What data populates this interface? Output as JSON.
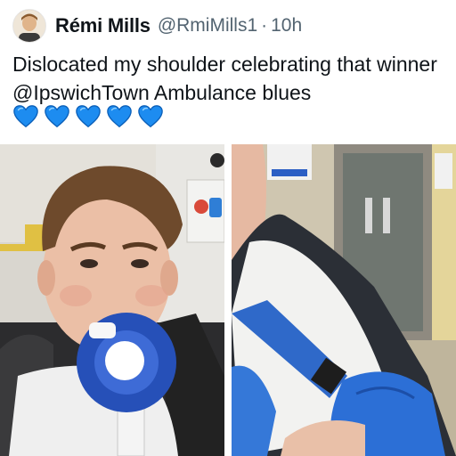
{
  "tweet": {
    "author_name": "Rémi Mills",
    "handle": "@RmiMills1",
    "separator": "·",
    "timestamp": "10h",
    "text_part1": "Dislocated my shoulder celebrating that winner ",
    "mention": "@IpswichTown",
    "text_part2": " Ambulance blues",
    "emoji": [
      "blue-heart",
      "blue-heart",
      "blue-heart",
      "blue-heart",
      "blue-heart"
    ],
    "emoji_color": "#1d8cf0"
  },
  "media": {
    "photos": [
      {
        "name": "selfie-with-gas-mask"
      },
      {
        "name": "arm-in-blue-sling"
      }
    ]
  }
}
